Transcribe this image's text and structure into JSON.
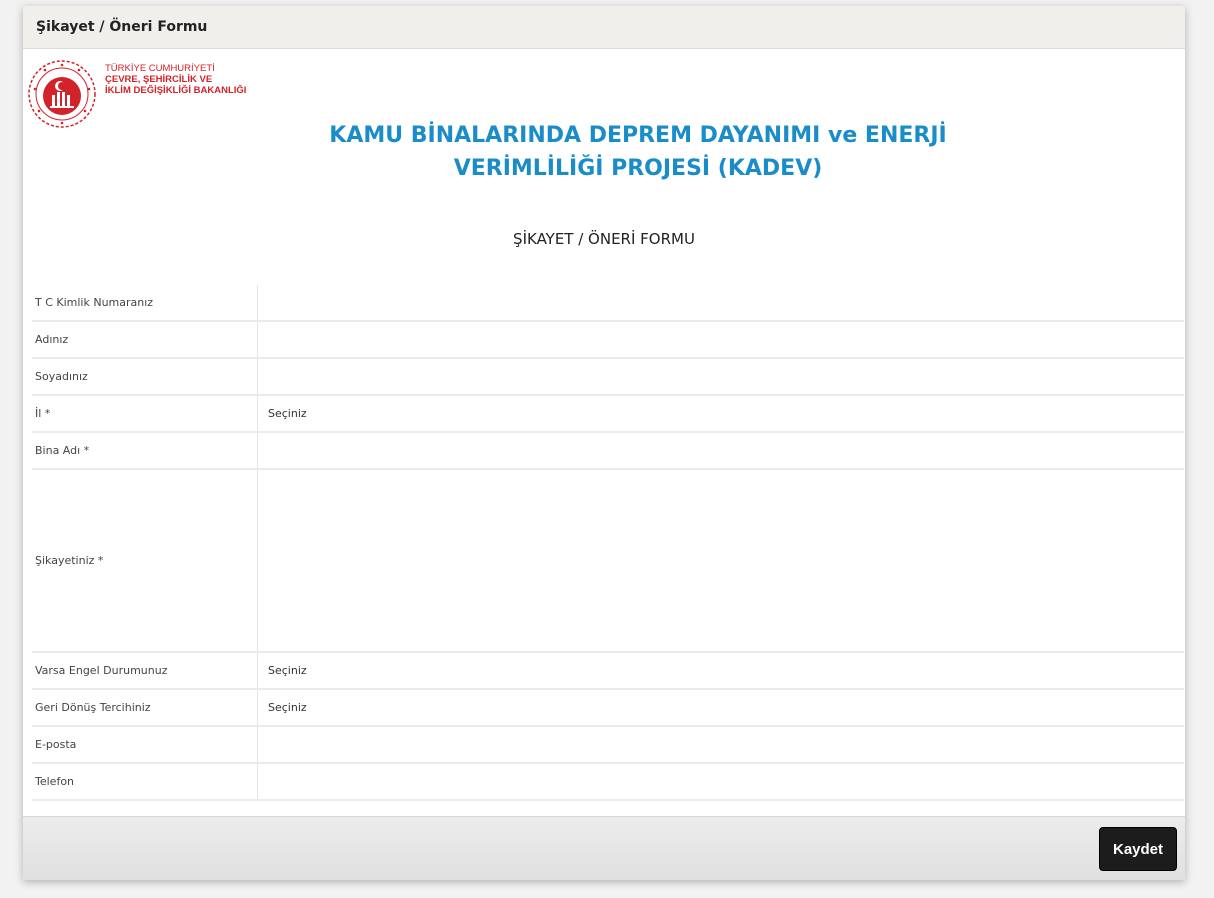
{
  "window": {
    "title": "Şikayet / Öneri Formu"
  },
  "header": {
    "ministry_line1": "TÜRKİYE CUMHURİYETİ",
    "ministry_line2": "ÇEVRE, ŞEHİRCİLİK VE",
    "ministry_line3": "İKLİM DEĞİŞİKLİĞİ BAKANLIĞI",
    "project_title_line1": "KAMU BİNALARINDA DEPREM DAYANIMI ve ENERJİ",
    "project_title_line2": "VERİMLİLİĞİ PROJESİ (KADEV)",
    "form_title": "ŞİKAYET / ÖNERİ FORMU"
  },
  "colors": {
    "brand_red": "#d2232a",
    "title_blue": "#1a8cc8",
    "button_bg": "#1c1c1c"
  },
  "form": {
    "rows": [
      {
        "label": "T C Kimlik Numaranız",
        "value": ""
      },
      {
        "label": "Adınız",
        "value": ""
      },
      {
        "label": "Soyadınız",
        "value": ""
      },
      {
        "label": "İl *",
        "value": "Seçiniz"
      },
      {
        "label": "Bina Adı *",
        "value": ""
      },
      {
        "label": "Şikayetiniz *",
        "value": ""
      },
      {
        "label": "Varsa Engel Durumunuz",
        "value": "Seçiniz"
      },
      {
        "label": "Geri Dönüş Tercihiniz",
        "value": "Seçiniz"
      },
      {
        "label": "E-posta",
        "value": ""
      },
      {
        "label": "Telefon",
        "value": ""
      }
    ]
  },
  "footer": {
    "save_label": "Kaydet"
  }
}
